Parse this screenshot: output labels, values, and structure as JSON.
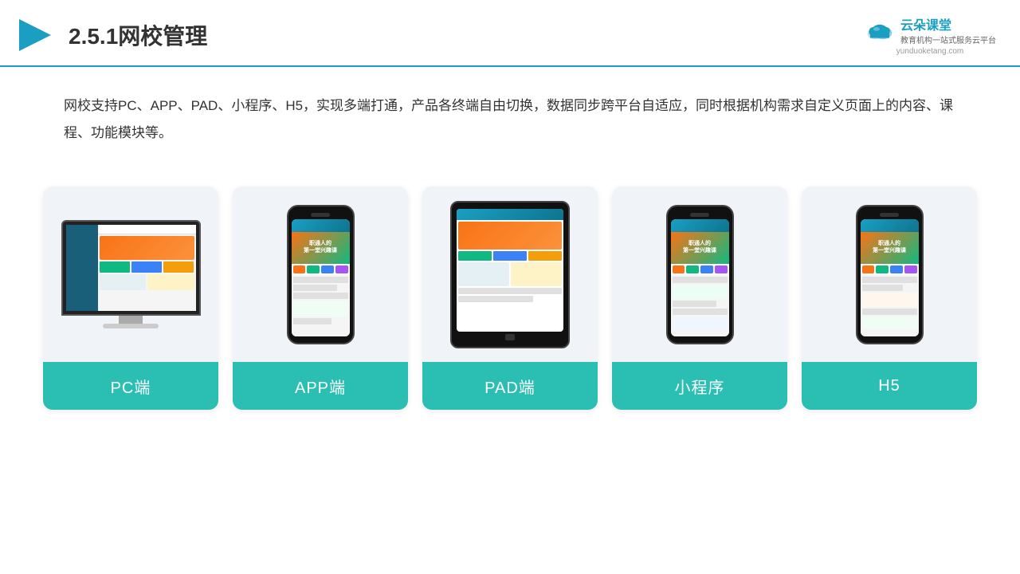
{
  "header": {
    "title": "2.5.1网校管理",
    "logo_name": "云朵课堂",
    "logo_url": "yunduoketang.com",
    "logo_tagline": "教育机构一站式服务云平台"
  },
  "description": {
    "text": "网校支持PC、APP、PAD、小程序、H5，实现多端打通，产品各终端自由切换，数据同步跨平台自适应，同时根据机构需求自定义页面上的内容、课程、功能模块等。"
  },
  "cards": [
    {
      "id": "pc",
      "label": "PC端"
    },
    {
      "id": "app",
      "label": "APP端"
    },
    {
      "id": "pad",
      "label": "PAD端"
    },
    {
      "id": "miniprogram",
      "label": "小程序"
    },
    {
      "id": "h5",
      "label": "H5"
    }
  ],
  "colors": {
    "accent": "#2bbfb3",
    "header_line": "#1a9fc3",
    "card_bg": "#f0f4f8"
  }
}
